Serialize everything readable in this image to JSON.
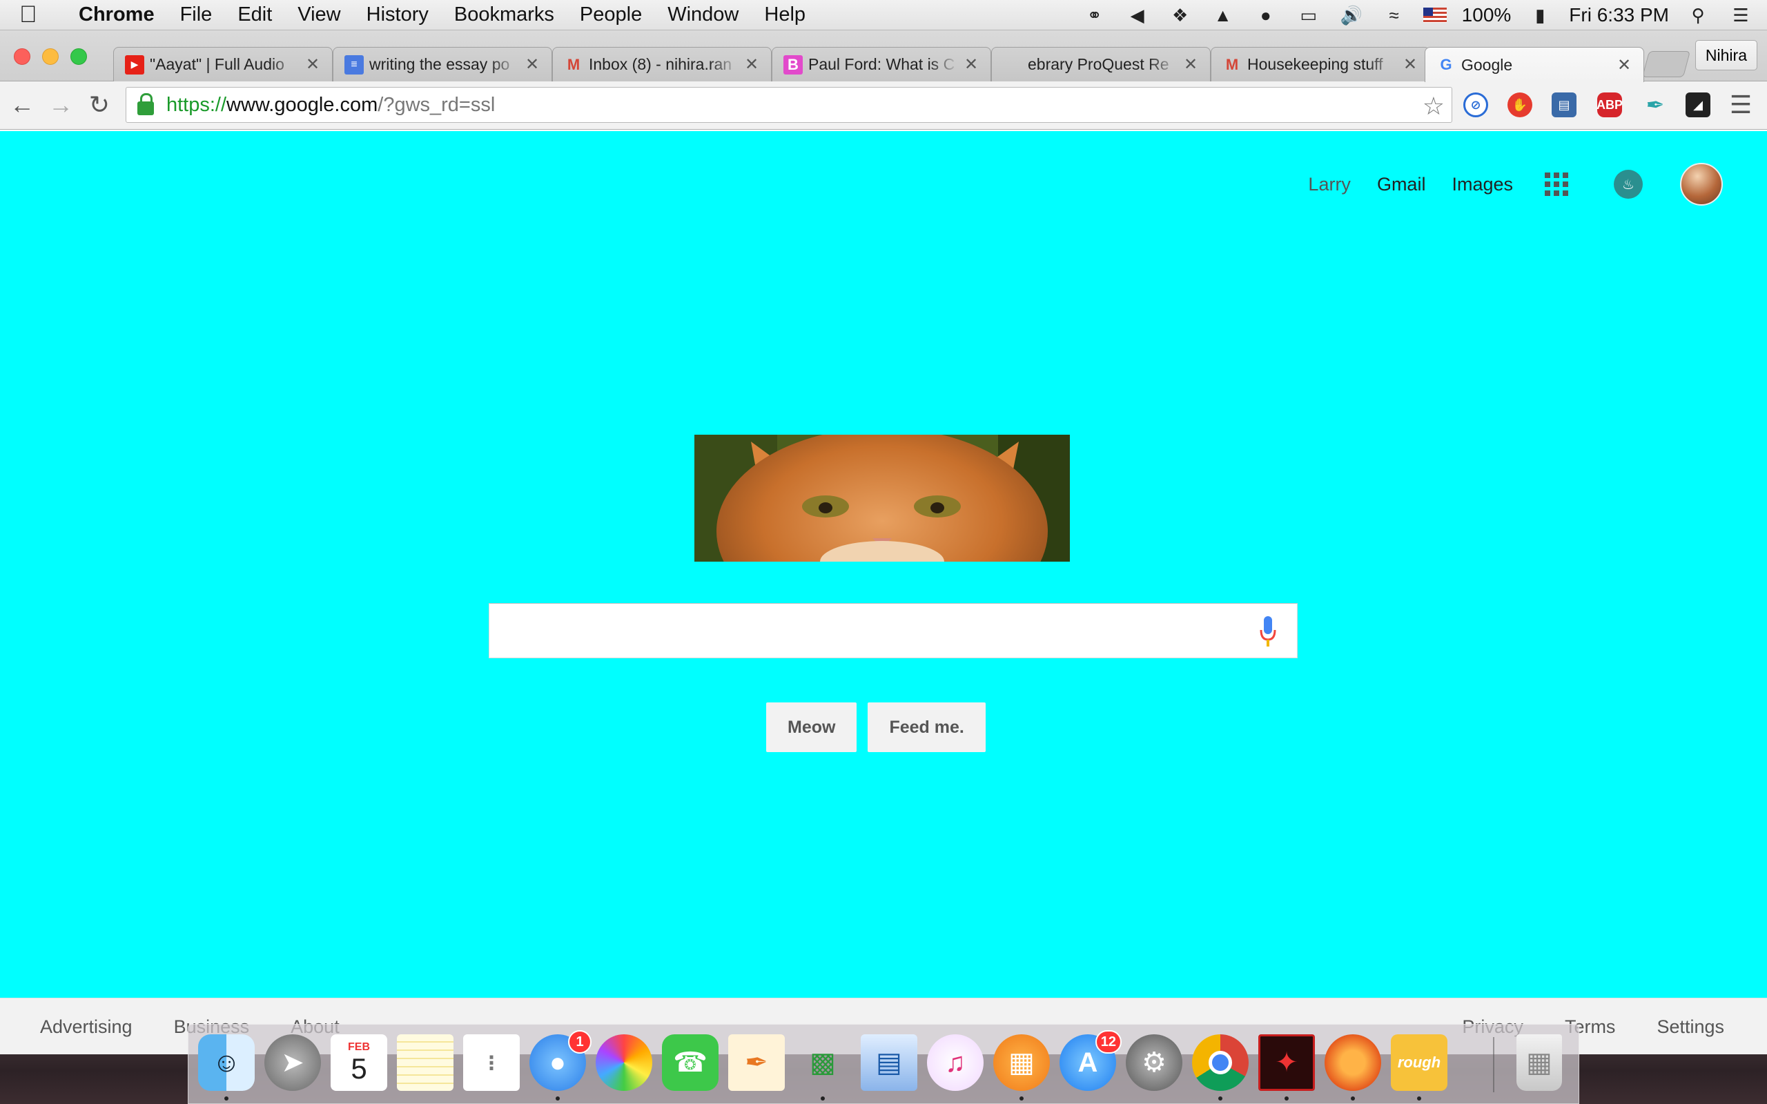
{
  "menubar": {
    "app_name": "Chrome",
    "menus": [
      "File",
      "Edit",
      "View",
      "History",
      "Bookmarks",
      "People",
      "Window",
      "Help"
    ],
    "battery": "100%",
    "clock": "Fri 6:33 PM"
  },
  "tabs": [
    {
      "title": "\"Aayat\" | Full Audio",
      "icon": "youtube-icon",
      "color": "#e62117"
    },
    {
      "title": "writing the essay po",
      "icon": "docs-icon",
      "color": "#4a7ae0"
    },
    {
      "title": "Inbox (8) - nihira.ran",
      "icon": "gmail-icon",
      "color": "#d44638"
    },
    {
      "title": "Paul Ford: What is C",
      "icon": "bloomberg-icon",
      "color": "#e24acb"
    },
    {
      "title": "ebrary ProQuest Re",
      "icon": "none",
      "color": ""
    },
    {
      "title": "Housekeeping stuff",
      "icon": "gmail-icon",
      "color": "#d44638"
    },
    {
      "title": "Google",
      "icon": "google-icon",
      "color": "#4285f4",
      "active": true
    }
  ],
  "profile_name": "Nihira",
  "url": {
    "scheme": "https://",
    "host": "www.google.com",
    "path": "/?gws_rd=ssl"
  },
  "extensions": [
    {
      "name": "blocker-icon",
      "label": "",
      "color": "#2a6cd6"
    },
    {
      "name": "hand-stop-icon",
      "label": "",
      "color": "#e63b2e"
    },
    {
      "name": "book-icon",
      "label": "",
      "color": "#3a6aa8"
    },
    {
      "name": "adblock-plus-icon",
      "label": "ABP",
      "color": "#d6252b"
    },
    {
      "name": "eyedropper-icon",
      "label": "",
      "color": "#2aa4a8"
    },
    {
      "name": "clip-icon",
      "label": "",
      "color": "#222222"
    }
  ],
  "page": {
    "background": "#00ffff",
    "topnav": {
      "user": "Larry",
      "gmail": "Gmail",
      "images": "Images"
    },
    "search_placeholder": "",
    "buttons": {
      "search": "Meow",
      "lucky": "Feed me."
    },
    "footer": {
      "left": [
        "Advertising",
        "Business",
        "About"
      ],
      "right": [
        "Privacy",
        "Terms",
        "Settings"
      ]
    }
  },
  "dock": {
    "calendar_month": "FEB",
    "calendar_day": "5",
    "messages_badge": "1",
    "appstore_badge": "12",
    "rough_label": "rough"
  }
}
